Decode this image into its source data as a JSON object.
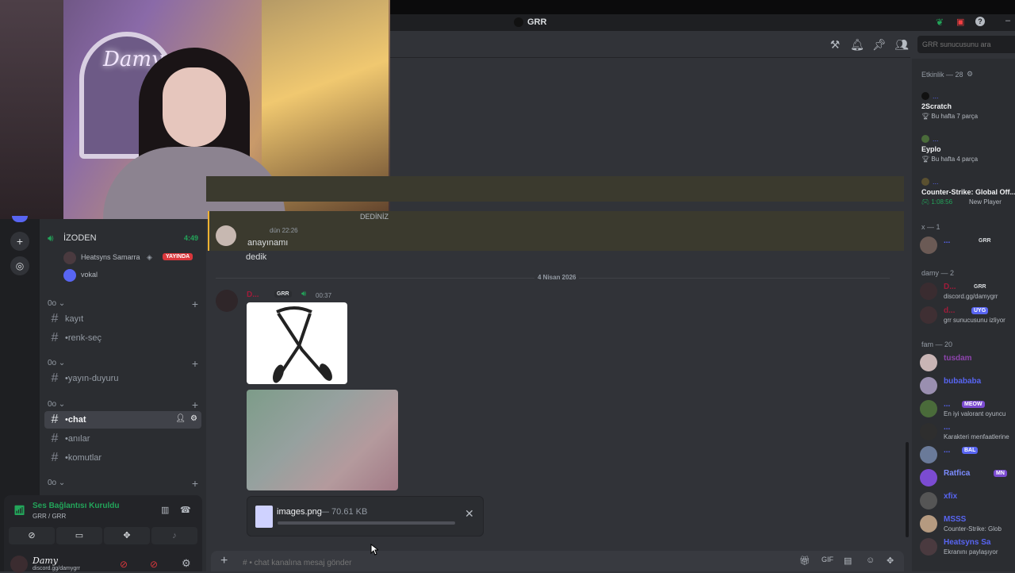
{
  "window": {
    "server_title": "GRR"
  },
  "header": {
    "search_placeholder": "GRR sunucusunu ara"
  },
  "sidebar": {
    "voice_channel": {
      "name": "İZODEN",
      "timer": "4:49"
    },
    "voice_users": [
      {
        "name": "Heatsyns Samarra",
        "badge": "YAYINDA"
      },
      {
        "name": "vokal"
      }
    ],
    "categories": [
      {
        "label": "0o",
        "channels": [
          "kayıt",
          "renk-seç"
        ]
      },
      {
        "label": "0o",
        "channels": [
          "yayın-duyuru"
        ]
      },
      {
        "label": "0o",
        "channels": [
          "chat",
          "anılar",
          "komutlar"
        ]
      },
      {
        "label": "0o",
        "channels": []
      }
    ],
    "active_channel": "chat"
  },
  "voice_panel": {
    "status": "Ses Bağlantısı Kuruldu",
    "location": "GRR / GRR"
  },
  "user_panel": {
    "name": "Damy",
    "status": "discord.gg/damygrr"
  },
  "chat": {
    "reply_preview": "DEDİNİZ",
    "message1": {
      "time": "dün 22:26",
      "lines": [
        "anayınamı",
        "dedik"
      ]
    },
    "date_divider": "4 Nisan 2026",
    "message2": {
      "tag": "GRR",
      "time": "00:37"
    },
    "upload": {
      "filename": "images.png",
      "size": "— 70.61 KB"
    },
    "input_placeholder": "# • chat kanalına mesaj gönder"
  },
  "members": {
    "activity_header": "Etkinlik — 28",
    "activities": [
      {
        "game": "2Scratch",
        "detail": "Bu hafta 7 parça"
      },
      {
        "game": "Eyplo",
        "detail": "Bu hafta 4 parça"
      },
      {
        "game": "Counter-Strike: Global Off...",
        "detail": "1:08:56",
        "extra": "New Player"
      }
    ],
    "sections": [
      {
        "title": "x — 1"
      },
      {
        "title": "damy — 2"
      },
      {
        "title": "fam — 20"
      }
    ],
    "x_members": [
      {
        "tag": "GRR"
      }
    ],
    "damy_members": [
      {
        "tag": "GRR",
        "status": "discord.gg/damygrr"
      },
      {
        "tag": "UYG",
        "status": "grr sunucusunu izliyor"
      }
    ],
    "fam_members": [
      {
        "name": "tusdam"
      },
      {
        "name": "bubababa"
      },
      {
        "tag": "MEOW",
        "status": "En iyi valorant oyuncu"
      },
      {
        "status": "Karakteri menfaatlerine"
      },
      {
        "tag": "BAL"
      },
      {
        "name": "Ratfica",
        "tag": "MN"
      },
      {
        "name": "xfix"
      },
      {
        "name": "MSSS",
        "status": "Counter-Strike: Glob"
      },
      {
        "name": "Heatsyns Sa",
        "status": "Ekranını paylaşıyor"
      }
    ]
  },
  "colors": {
    "accent_green": "#23a55a",
    "live_red": "#da373c",
    "blurple": "#5865f2"
  }
}
